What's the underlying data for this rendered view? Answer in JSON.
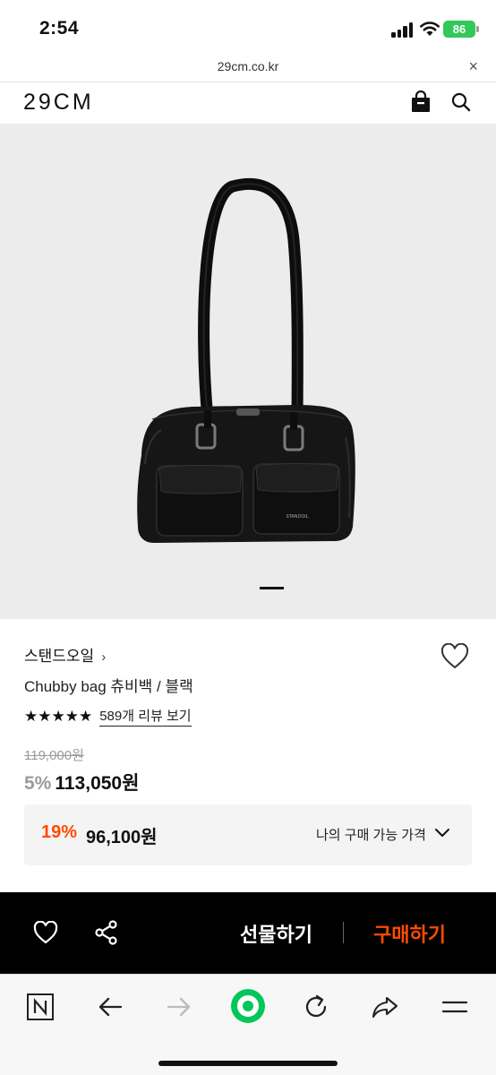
{
  "status_bar": {
    "time": "2:54",
    "battery": "86"
  },
  "url_bar": {
    "url": "29cm.co.kr",
    "close": "×"
  },
  "header": {
    "logo": "29CM"
  },
  "product": {
    "brand": "스탠드오일",
    "brand_chevron": "›",
    "name": "Chubby bag 츄비백 / 블랙",
    "stars": "★★★★★",
    "rating_value": 5,
    "review_link": "589개 리뷰 보기",
    "original_price": "119,000원",
    "discount_pct": "5%",
    "sale_price": "113,050원",
    "image_count_indicator": "slide 2 active",
    "bag_label": "STANDOIL"
  },
  "my_price": {
    "pct": "19%",
    "price": "96,100원",
    "label": "나의 구매 가능 가격"
  },
  "action_bar": {
    "gift_label": "선물하기",
    "buy_label": "구매하기"
  },
  "colors": {
    "accent": "#ff4b00",
    "image_bg": "#ececec",
    "action_bar_bg": "#000000",
    "battery": "#34c759",
    "naver_green": "#03c75a"
  },
  "icons": [
    "signal-icon",
    "wifi-icon",
    "battery-icon",
    "close-icon",
    "shopping-bag-icon",
    "search-icon",
    "heart-icon",
    "star-icon",
    "chevron-down-icon",
    "share-icon",
    "naver-icon",
    "back-arrow-icon",
    "forward-arrow-icon",
    "home-dot-icon",
    "refresh-icon",
    "share-arrow-icon",
    "menu-icon"
  ]
}
